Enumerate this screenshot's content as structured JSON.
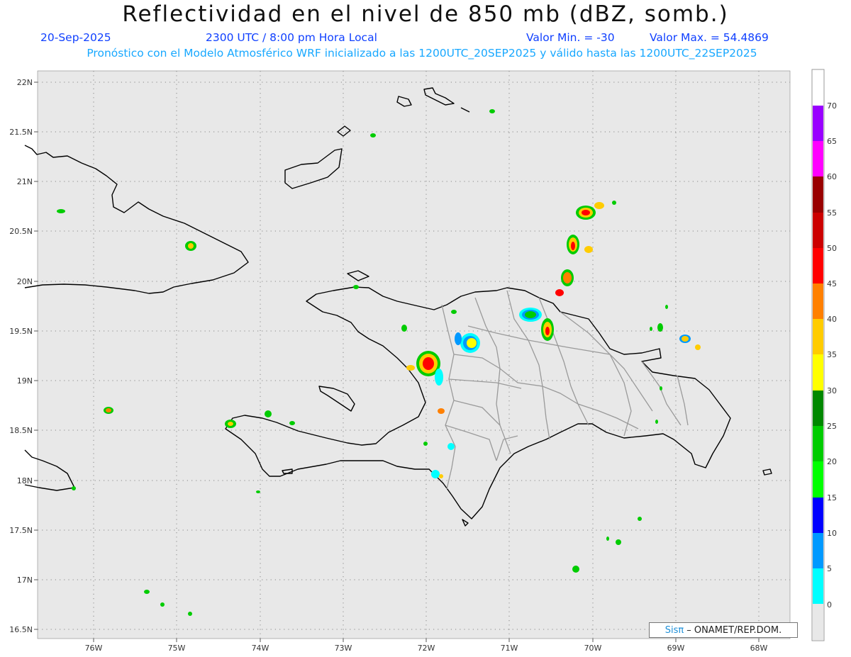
{
  "header": {
    "title": "Reflectividad en el nivel de 850 mb (dBZ, somb.)",
    "date": "20-Sep-2025",
    "time": "2300 UTC / 8:00 pm Hora Local",
    "min_label": "Valor Min. = -30",
    "max_label": "Valor Max. = 54.4869",
    "forecast_line": "Pronóstico con el Modelo Atmosférico WRF inicializado a las 1200UTC_20SEP2025 y válido hasta las  1200UTC_22SEP2025"
  },
  "map": {
    "lat_ticks": [
      "22N",
      "21.5N",
      "21N",
      "20.5N",
      "20N",
      "19.5N",
      "19N",
      "18.5N",
      "18N",
      "17.5N",
      "17N",
      "16.5N"
    ],
    "lon_ticks": [
      "76W",
      "75W",
      "74W",
      "73W",
      "72W",
      "71W",
      "70W",
      "69W",
      "68W"
    ],
    "background_color": "#e8e8e8",
    "coastline_color": "#000000",
    "province_border_color": "#9a9a9a",
    "grid": "dotted"
  },
  "colorbar": {
    "labels": [
      "0",
      "5",
      "10",
      "15",
      "20",
      "25",
      "30",
      "35",
      "40",
      "45",
      "50",
      "55",
      "60",
      "65",
      "70"
    ],
    "colors": [
      "#00ffff",
      "#0099ff",
      "#0000ff",
      "#00ff00",
      "#00cc00",
      "#008800",
      "#ffff00",
      "#ffcc00",
      "#ff8000",
      "#ff0000",
      "#cc0000",
      "#990000",
      "#ff00ff",
      "#9900ff"
    ]
  },
  "credit": {
    "brand": "Sisπ",
    "text": "– ONAMET/REP.DOM."
  }
}
